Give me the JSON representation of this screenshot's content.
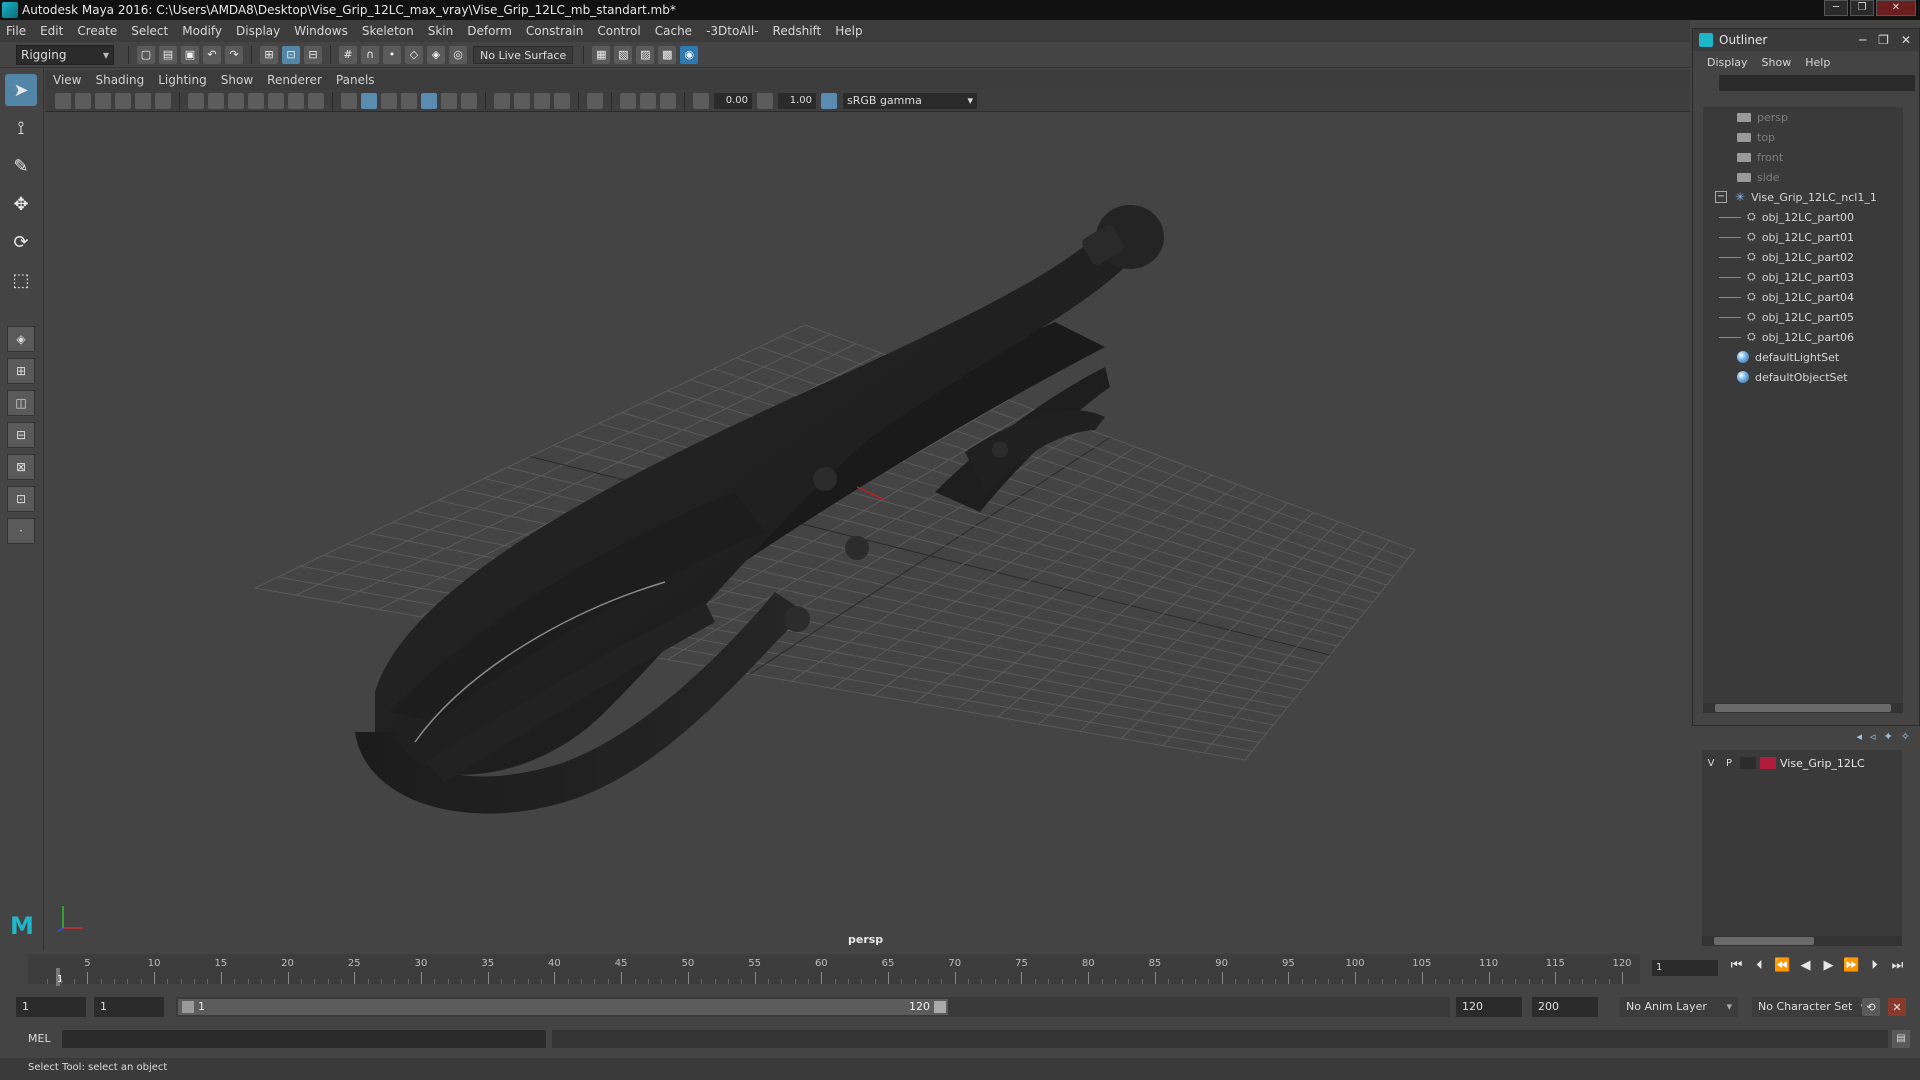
{
  "window": {
    "title": "Autodesk Maya 2016: C:\\Users\\AMDA8\\Desktop\\Vise_Grip_12LC_max_vray\\Vise_Grip_12LC_mb_standart.mb*"
  },
  "menubar": [
    "File",
    "Edit",
    "Create",
    "Select",
    "Modify",
    "Display",
    "Windows",
    "Skeleton",
    "Skin",
    "Deform",
    "Constrain",
    "Control",
    "Cache",
    "-3DtoAll-",
    "Redshift",
    "Help"
  ],
  "statusline": {
    "mode": "Rigging",
    "live_surface": "No Live Surface"
  },
  "viewport": {
    "menu": [
      "View",
      "Shading",
      "Lighting",
      "Show",
      "Renderer",
      "Panels"
    ],
    "exposure": "0.00",
    "gamma": "1.00",
    "color_space": "sRGB gamma",
    "camera": "persp"
  },
  "outliner": {
    "title": "Outliner",
    "menu": [
      "Display",
      "Show",
      "Help"
    ],
    "cameras": [
      "persp",
      "top",
      "front",
      "side"
    ],
    "group": "Vise_Grip_12LC_ncl1_1",
    "parts": [
      "obj_12LC_part00",
      "obj_12LC_part01",
      "obj_12LC_part02",
      "obj_12LC_part03",
      "obj_12LC_part04",
      "obj_12LC_part05",
      "obj_12LC_part06"
    ],
    "sets": [
      "defaultLightSet",
      "defaultObjectSet"
    ]
  },
  "layers": {
    "v_label": "V",
    "p_label": "P",
    "name": "Vise_Grip_12LC",
    "color": "#b01c3c"
  },
  "timeslider": {
    "ticks": [
      "5",
      "10",
      "15",
      "20",
      "25",
      "30",
      "35",
      "40",
      "45",
      "50",
      "55",
      "60",
      "65",
      "70",
      "75",
      "80",
      "85",
      "90",
      "95",
      "100",
      "105",
      "110",
      "115",
      "120"
    ],
    "current": "1",
    "current_frame_field": "1"
  },
  "rangeslider": {
    "start_field": "1",
    "start_field2": "1",
    "range_start": "1",
    "range_end": "120",
    "end_field": "120",
    "end_field2": "200",
    "anim_layer": "No Anim Layer",
    "character_set": "No Character Set"
  },
  "cmdline": {
    "label": "MEL"
  },
  "helpline": {
    "text": "Select Tool: select an object"
  },
  "colors": {
    "accent": "#5285a6",
    "maya_teal": "#1fb6c8",
    "bg": "#444444"
  }
}
